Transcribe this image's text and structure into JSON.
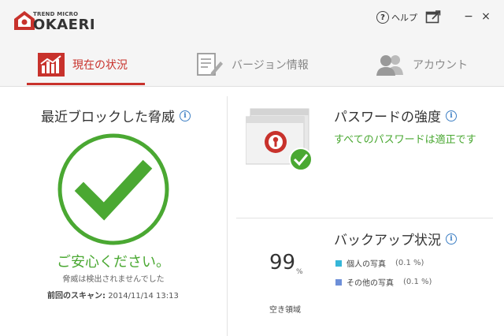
{
  "header": {
    "brand_small": "TREND MICRO",
    "brand_name": "OKAERI",
    "help_label": "ヘルプ",
    "minimize": "−",
    "close": "×"
  },
  "tabs": [
    {
      "label": "現在の状況",
      "icon": "bar-chart-icon",
      "active": true
    },
    {
      "label": "バージョン情報",
      "icon": "document-edit-icon",
      "active": false
    },
    {
      "label": "アカウント",
      "icon": "users-icon",
      "active": false
    }
  ],
  "threats": {
    "title": "最近ブロックした脅威",
    "status": "ご安心ください。",
    "detail": "脅威は検出されませんでした",
    "last_scan_label": "前回のスキャン:",
    "last_scan_value": "2014/11/14 13:13"
  },
  "password": {
    "title": "パスワードの強度",
    "status": "すべてのパスワードは適正です"
  },
  "backup": {
    "title": "バックアップ状況",
    "percent": "99",
    "percent_unit": "%",
    "free_space_label": "空き領域",
    "items": [
      {
        "label": "個人の写真",
        "value": "(0.1 %)",
        "color": "#35b6d8"
      },
      {
        "label": "その他の写真",
        "value": "(0.1 %)",
        "color": "#6d8fd8"
      }
    ]
  },
  "colors": {
    "accent": "#c8322c",
    "success": "#4aa832",
    "info": "#3d7fc4"
  }
}
